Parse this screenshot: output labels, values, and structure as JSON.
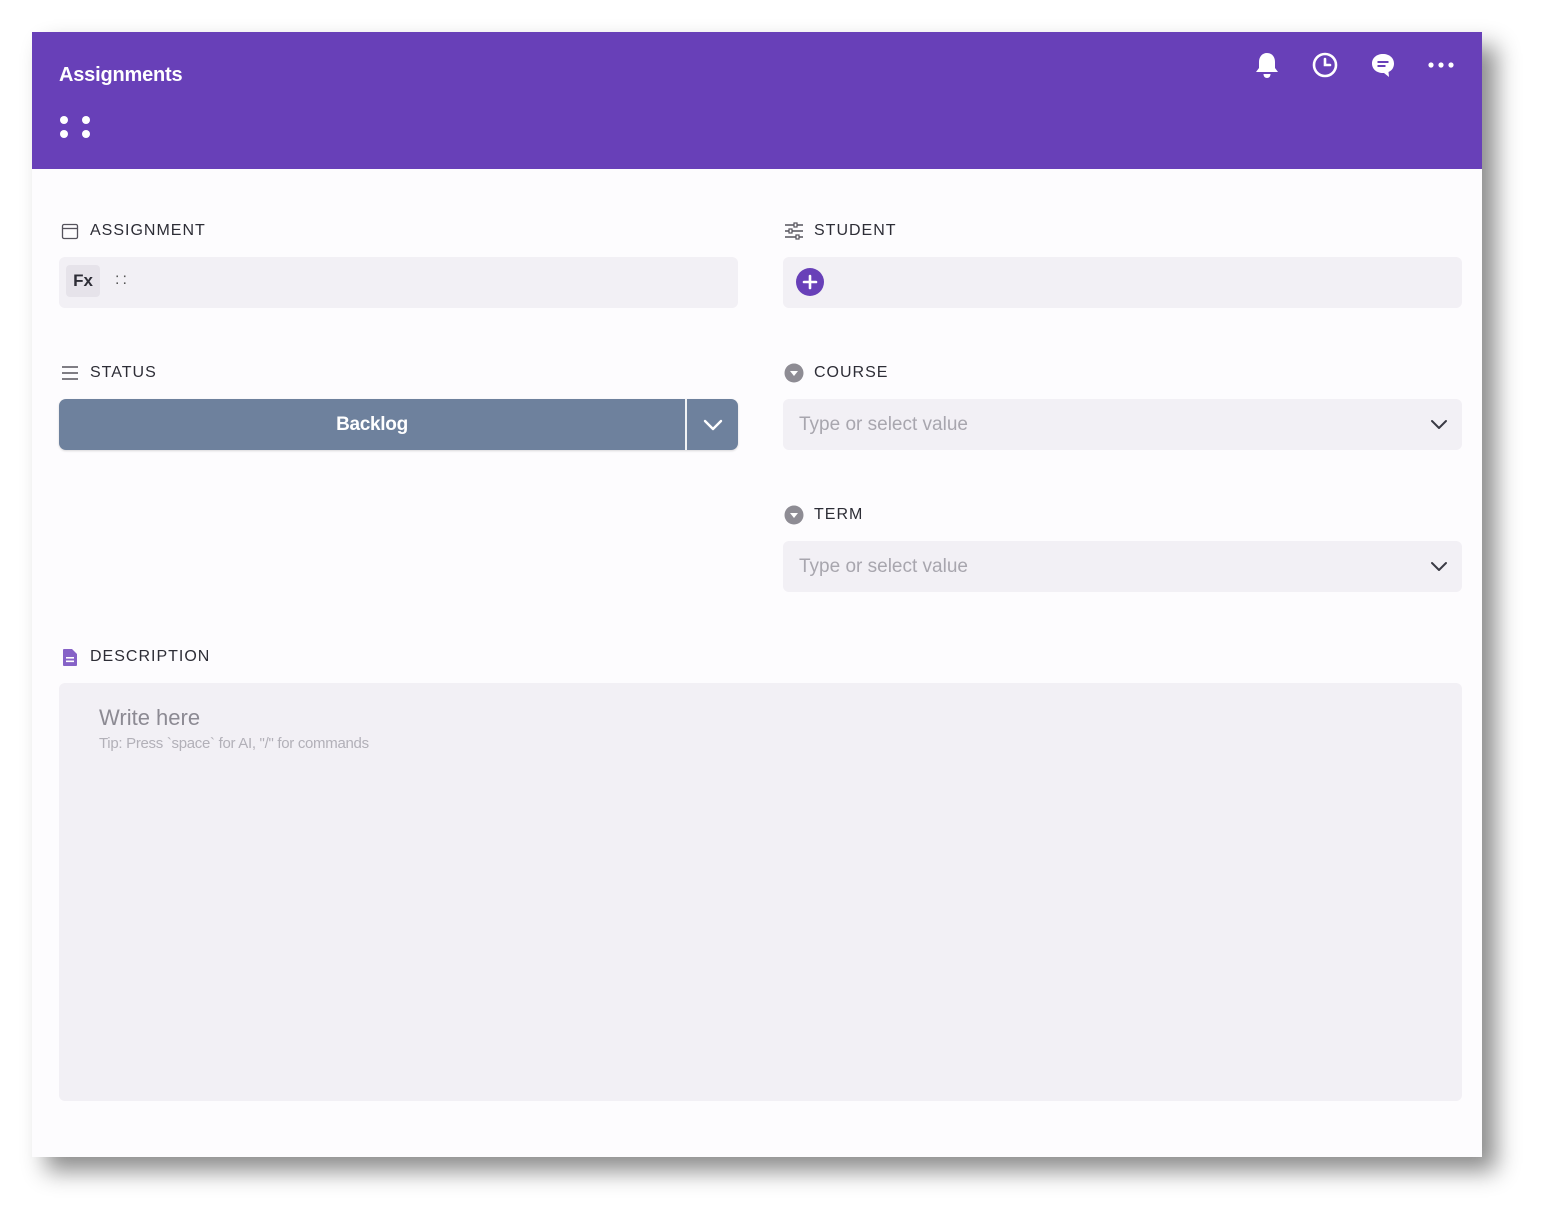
{
  "header": {
    "title": "Assignments",
    "icons": [
      "bell-icon",
      "clock-icon",
      "comment-icon",
      "more-icon"
    ]
  },
  "fields": {
    "assignment": {
      "label": "ASSIGNMENT",
      "icon": "calendar-icon",
      "fx_label": "Fx",
      "separator": "::"
    },
    "student": {
      "label": "STUDENT",
      "icon": "sliders-icon"
    },
    "status": {
      "label": "STATUS",
      "icon": "list-icon",
      "value": "Backlog",
      "color": "#6e819d"
    },
    "course": {
      "label": "COURSE",
      "icon": "dropdown-circle-icon",
      "placeholder": "Type or select value"
    },
    "term": {
      "label": "TERM",
      "icon": "dropdown-circle-icon",
      "placeholder": "Type or select value"
    },
    "description": {
      "label": "DESCRIPTION",
      "icon": "document-icon",
      "placeholder": "Write here",
      "tip": "Tip: Press `space` for AI, \"/\" for commands"
    }
  },
  "colors": {
    "accent": "#6840b8",
    "field_bg": "#f2f0f5",
    "status": "#6e819d"
  }
}
